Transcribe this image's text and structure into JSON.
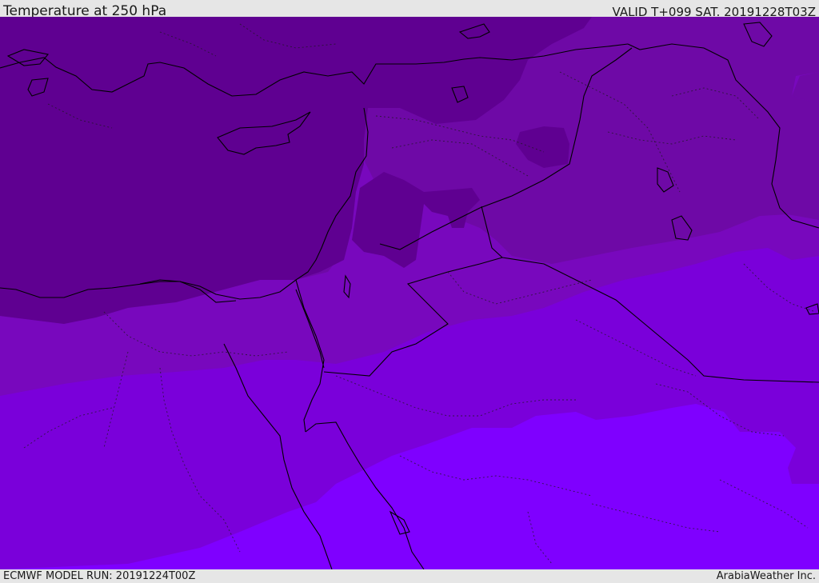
{
  "header": {
    "title": "Temperature at 250 hPa",
    "valid": "VALID T+099 SAT. 20191228T03Z"
  },
  "footer": {
    "model_run": "ECMWF MODEL RUN: 20191224T00Z",
    "credit": "ArabiaWeather Inc."
  },
  "colors": {
    "band_coldest": "#5f0091",
    "band_cold": "#6e09a6",
    "band_mid": "#7808bd",
    "band_warm": "#7a00da",
    "band_warmest": "#7f00ff",
    "coastline": "#000000",
    "chrome": "#e6e6e6"
  }
}
